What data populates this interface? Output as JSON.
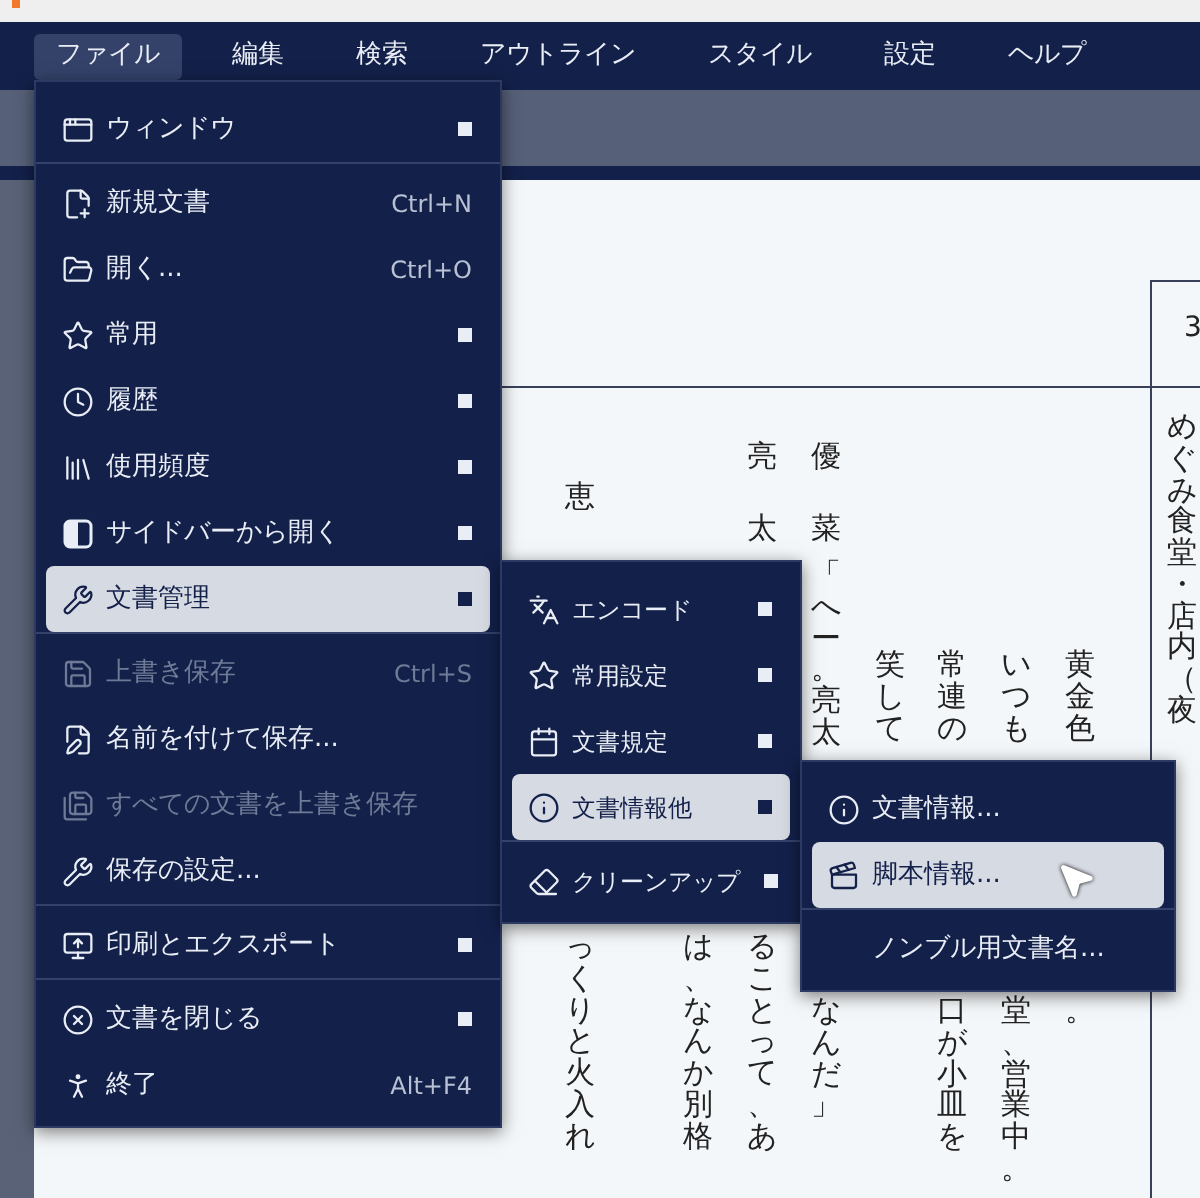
{
  "menubar": [
    {
      "label": "ファイル",
      "selected": true
    },
    {
      "label": "編集",
      "selected": false
    },
    {
      "label": "検索",
      "selected": false
    },
    {
      "label": "アウトライン",
      "selected": false
    },
    {
      "label": "スタイル",
      "selected": false
    },
    {
      "label": "設定",
      "selected": false
    },
    {
      "label": "ヘルプ",
      "selected": false
    }
  ],
  "document": {
    "page_number": "3",
    "columns": [
      {
        "segments": [
          {
            "kind": "name",
            "text": "恵"
          },
          {
            "kind": "line",
            "text": "っくりと火入れ"
          }
        ]
      },
      {
        "segments": [
          {
            "kind": "line",
            "text": "は、なんか別格"
          }
        ]
      },
      {
        "segments": [
          {
            "kind": "name",
            "text": "亮太"
          },
          {
            "kind": "line",
            "text": "ることって、あ"
          }
        ]
      },
      {
        "segments": [
          {
            "kind": "name",
            "text": "優菜"
          },
          {
            "kind": "line",
            "text": "「へー。亮太"
          },
          {
            "kind": "line",
            "text": "なんだ」"
          }
        ]
      },
      {
        "segments": [
          {
            "kind": "line",
            "text": "笑して"
          }
        ]
      },
      {
        "segments": [
          {
            "kind": "line",
            "text": "常連の"
          },
          {
            "kind": "line",
            "text": "口が小皿を"
          }
        ]
      },
      {
        "segments": [
          {
            "kind": "line",
            "text": "いつも"
          },
          {
            "kind": "line",
            "text": "堂、営業中。"
          }
        ]
      },
      {
        "segments": [
          {
            "kind": "line",
            "text": "黄金色"
          },
          {
            "kind": "line",
            "text": "。"
          }
        ]
      },
      {
        "segments": [
          {
            "kind": "line",
            "text": "めぐみ食堂・店内（夜"
          }
        ]
      }
    ]
  },
  "file_menu": {
    "groups": [
      [
        {
          "label": "ウィンドウ",
          "submenu": true,
          "selected": false,
          "disabled": false
        }
      ],
      [
        {
          "label": "新規文書",
          "shortcut": "Ctrl+N",
          "submenu": false,
          "selected": false,
          "disabled": false
        },
        {
          "label": "開く...",
          "shortcut": "Ctrl+O",
          "submenu": false,
          "selected": false,
          "disabled": false
        },
        {
          "label": "常用",
          "submenu": true,
          "selected": false,
          "disabled": false
        },
        {
          "label": "履歴",
          "submenu": true,
          "selected": false,
          "disabled": false
        },
        {
          "label": "使用頻度",
          "submenu": true,
          "selected": false,
          "disabled": false
        },
        {
          "label": "サイドバーから開く",
          "submenu": true,
          "selected": false,
          "disabled": false
        },
        {
          "label": "文書管理",
          "submenu": true,
          "selected": true,
          "disabled": false
        }
      ],
      [
        {
          "label": "上書き保存",
          "shortcut": "Ctrl+S",
          "submenu": false,
          "selected": false,
          "disabled": true
        },
        {
          "label": "名前を付けて保存...",
          "submenu": false,
          "selected": false,
          "disabled": false
        },
        {
          "label": "すべての文書を上書き保存",
          "submenu": false,
          "selected": false,
          "disabled": true
        },
        {
          "label": "保存の設定...",
          "submenu": false,
          "selected": false,
          "disabled": false
        }
      ],
      [
        {
          "label": "印刷とエクスポート",
          "submenu": true,
          "selected": false,
          "disabled": false
        }
      ],
      [
        {
          "label": "文書を閉じる",
          "submenu": true,
          "selected": false,
          "disabled": false
        },
        {
          "label": "終了",
          "shortcut": "Alt+F4",
          "submenu": false,
          "selected": false,
          "disabled": false
        }
      ]
    ]
  },
  "document_menu": {
    "groups": [
      [
        {
          "label": "エンコード",
          "submenu": true,
          "selected": false
        },
        {
          "label": "常用設定",
          "submenu": true,
          "selected": false
        },
        {
          "label": "文書規定",
          "submenu": true,
          "selected": false
        },
        {
          "label": "文書情報他",
          "submenu": true,
          "selected": true
        }
      ],
      [
        {
          "label": "クリーンアップ",
          "submenu": true,
          "selected": false
        }
      ]
    ]
  },
  "info_menu": {
    "groups": [
      [
        {
          "label": "文書情報...",
          "selected": false
        },
        {
          "label": "脚本情報...",
          "selected": true
        }
      ],
      [
        {
          "label": "ノンブル用文書名...",
          "selected": false
        }
      ]
    ]
  }
}
